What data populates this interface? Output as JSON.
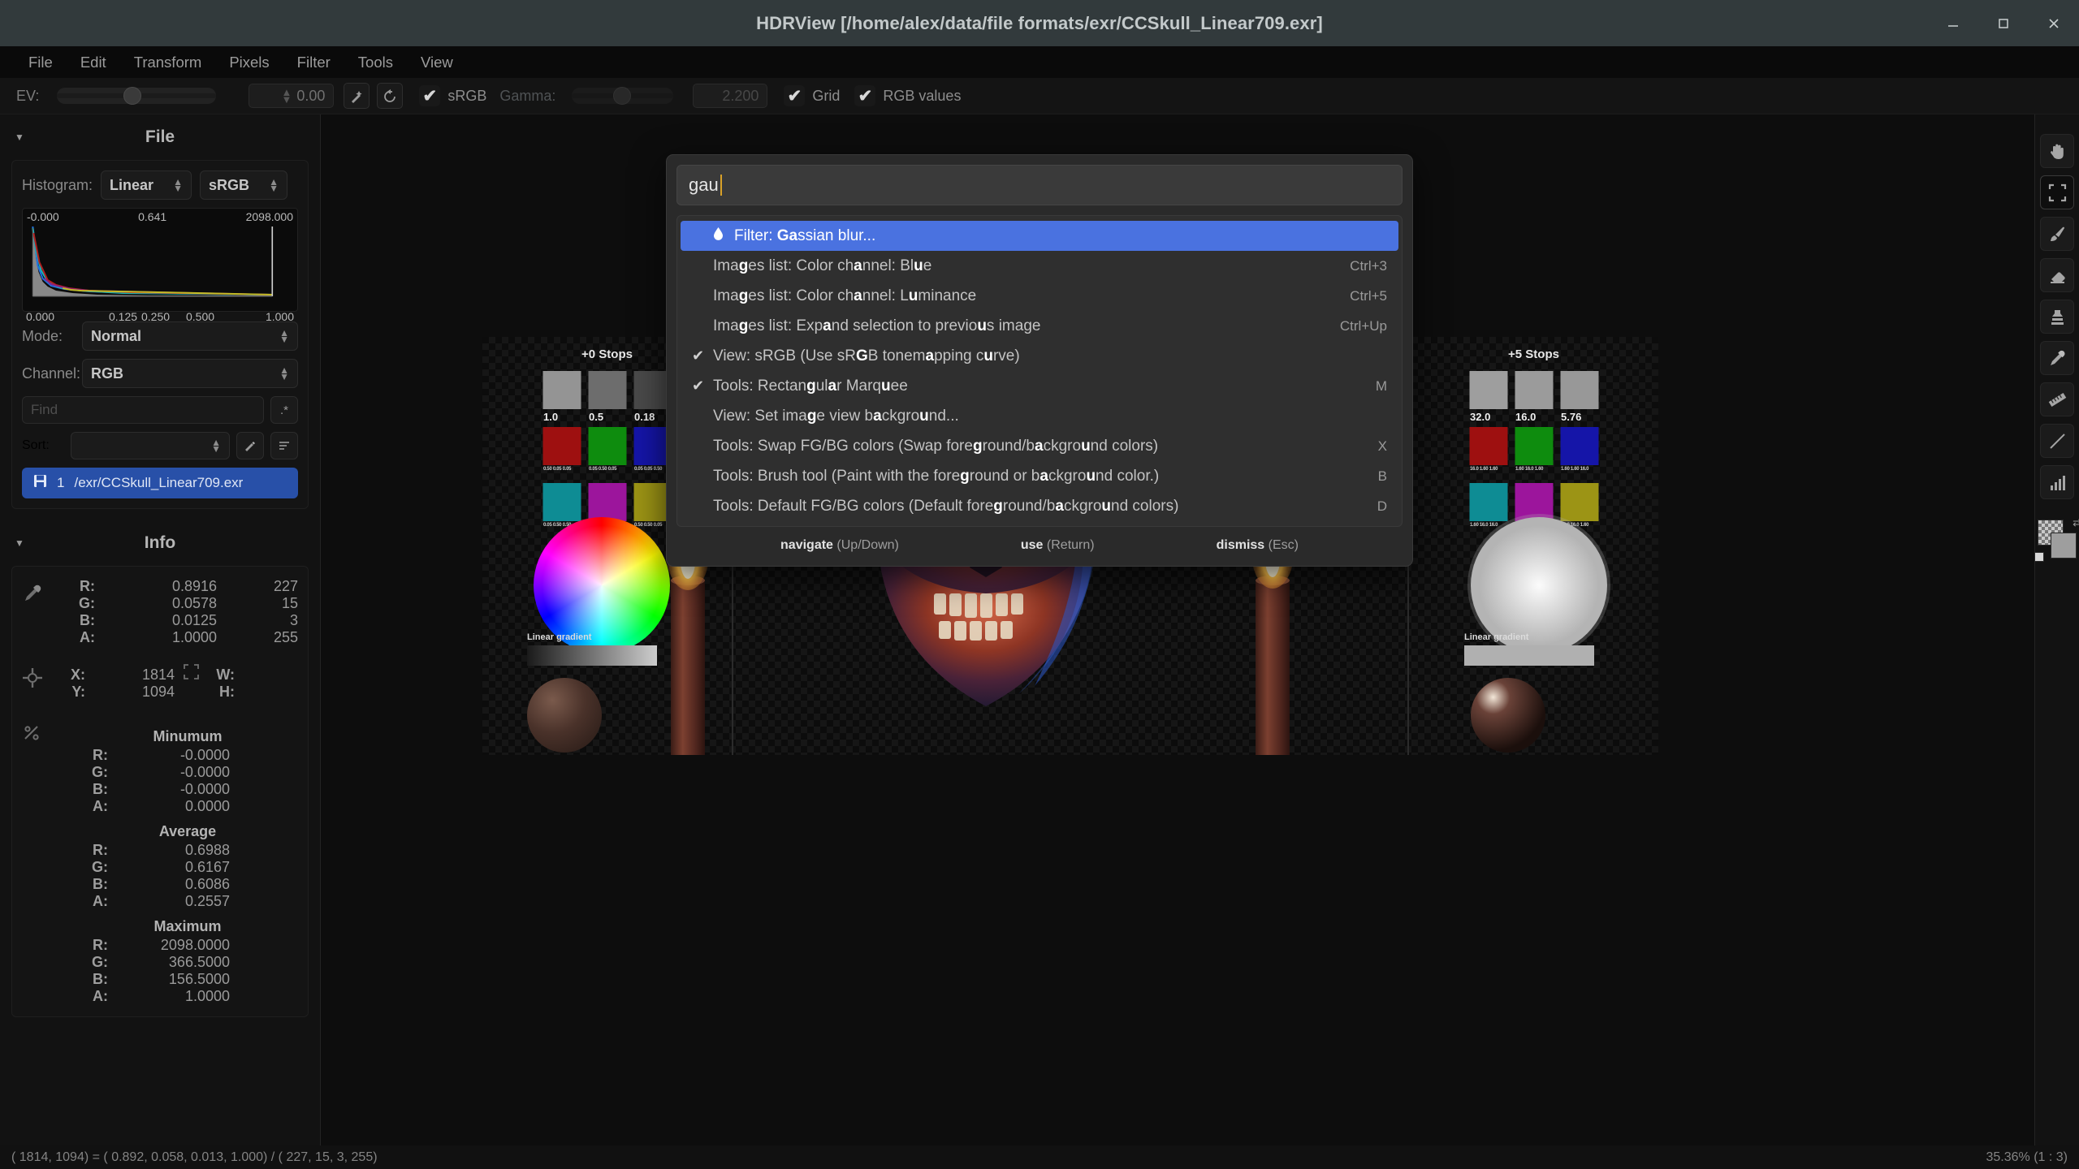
{
  "window": {
    "title": "HDRView [/home/alex/data/file formats/exr/CCSkull_Linear709.exr]",
    "minimize_icon": "minimize-icon",
    "maximize_icon": "maximize-icon",
    "close_icon": "close-icon"
  },
  "menubar": {
    "items": [
      {
        "label": "File"
      },
      {
        "label": "Edit"
      },
      {
        "label": "Transform"
      },
      {
        "label": "Pixels"
      },
      {
        "label": "Filter"
      },
      {
        "label": "Tools"
      },
      {
        "label": "View"
      }
    ]
  },
  "toolbar": {
    "ev_label": "EV:",
    "ev_value": "0.00",
    "auto_exposure_icon": "magic-wand-icon",
    "reset_icon": "reset-icon",
    "srgb_label": "sRGB",
    "srgb_checked": true,
    "gamma_label": "Gamma:",
    "gamma_value": "2.200",
    "gamma_enabled": false,
    "grid_label": "Grid",
    "grid_checked": true,
    "rgb_values_label": "RGB values",
    "rgb_values_checked": true
  },
  "file_panel": {
    "title": "File",
    "collapse_icon": "chevron-down-icon",
    "histogram_label": "Histogram:",
    "histogram_scale": "Linear",
    "histogram_colorspace": "sRGB",
    "hist_top_labels": [
      "-0.000",
      "0.641",
      "2098.000"
    ],
    "hist_bottom_labels": [
      "0.000",
      "0.125",
      "0.250",
      "0.500",
      "1.000"
    ],
    "mode_label": "Mode:",
    "mode_value": "Normal",
    "channel_label": "Channel:",
    "channel_value": "RGB",
    "find_placeholder": "Find",
    "regex_icon": "regex-icon",
    "sort_label": "Sort:",
    "sort_value": "",
    "sort_edit_icon": "pencil-icon",
    "sort_list_icon": "list-icon",
    "files": [
      {
        "index": "1",
        "name": "/exr/CCSkull_Linear709.exr",
        "icon": "save-icon",
        "selected": true
      }
    ]
  },
  "info_panel": {
    "title": "Info",
    "collapse_icon": "chevron-down-icon",
    "eyedropper_icon": "eyedropper-icon",
    "crosshair_icon": "crosshair-icon",
    "stats_icon": "percent-icon",
    "select_icon": "selection-icon",
    "pixel": [
      {
        "k": "R:",
        "v": "0.8916",
        "v2": "227"
      },
      {
        "k": "G:",
        "v": "0.0578",
        "v2": "15"
      },
      {
        "k": "B:",
        "v": "0.0125",
        "v2": "3"
      },
      {
        "k": "A:",
        "v": "1.0000",
        "v2": "255"
      }
    ],
    "coords": {
      "x_label": "X:",
      "x_value": "1814",
      "y_label": "Y:",
      "y_value": "1094",
      "w_label": "W:",
      "w_value": "",
      "h_label": "H:",
      "h_value": ""
    },
    "minimum_title": "Minumum",
    "minimum": [
      {
        "k": "R:",
        "v": "-0.0000"
      },
      {
        "k": "G:",
        "v": "-0.0000"
      },
      {
        "k": "B:",
        "v": "-0.0000"
      },
      {
        "k": "A:",
        "v": "0.0000"
      }
    ],
    "average_title": "Average",
    "average": [
      {
        "k": "R:",
        "v": "0.6988"
      },
      {
        "k": "G:",
        "v": "0.6167"
      },
      {
        "k": "B:",
        "v": "0.6086"
      },
      {
        "k": "A:",
        "v": "0.2557"
      }
    ],
    "maximum_title": "Maximum",
    "maximum": [
      {
        "k": "R:",
        "v": "2098.0000"
      },
      {
        "k": "G:",
        "v": "366.5000"
      },
      {
        "k": "B:",
        "v": "156.5000"
      },
      {
        "k": "A:",
        "v": "1.0000"
      }
    ]
  },
  "canvas": {
    "left_chart": {
      "stops_label": "+0 Stops",
      "gray_captions": [
        "1.0",
        "0.5",
        "0.18"
      ],
      "gradient_label": "Linear gradient"
    },
    "right_chart": {
      "stops_label": "+5 Stops",
      "gray_captions": [
        "32.0",
        "16.0",
        "5.76"
      ],
      "gradient_label": "Linear gradient"
    }
  },
  "right_tools": {
    "items": [
      {
        "name": "hand-tool",
        "icon": "hand-icon",
        "active": false
      },
      {
        "name": "rectangular-marquee-tool",
        "icon": "marquee-icon",
        "active": true
      },
      {
        "name": "brush-tool",
        "icon": "brush-icon",
        "active": false
      },
      {
        "name": "eraser-tool",
        "icon": "eraser-icon",
        "active": false
      },
      {
        "name": "clone-stamp-tool",
        "icon": "stamp-icon",
        "active": false
      },
      {
        "name": "eyedropper-tool",
        "icon": "eyedropper-icon",
        "active": false
      },
      {
        "name": "ruler-tool",
        "icon": "ruler-icon",
        "active": false
      },
      {
        "name": "line-tool",
        "icon": "line-icon",
        "active": false
      },
      {
        "name": "histogram-tool",
        "icon": "bar-chart-icon",
        "active": false
      }
    ],
    "fgbg_swap_icon": "swap-icon",
    "fgbg_default_icon": "default-colors-icon"
  },
  "statusbar": {
    "pixel_readout": "( 1814, 1094) = ( 0.892,  0.058,  0.013,  1.000) / ( 227,  15,   3,  255)",
    "zoom": "35.36% (1 : 3)"
  },
  "command_palette": {
    "query": "gau",
    "items": [
      {
        "icon": "droplet-icon",
        "check": "",
        "selected": true,
        "shortcut": "",
        "parts": [
          {
            "t": "Filter: ",
            "m": false
          },
          {
            "t": "Ga",
            "m": true
          },
          {
            "t": "ssian blur...",
            "m": false
          }
        ]
      },
      {
        "icon": "",
        "check": "",
        "selected": false,
        "shortcut": "Ctrl+3",
        "parts": [
          {
            "t": "Ima",
            "m": false
          },
          {
            "t": "g",
            "m": true
          },
          {
            "t": "es list: Color ch",
            "m": false
          },
          {
            "t": "a",
            "m": true
          },
          {
            "t": "nnel: Bl",
            "m": false
          },
          {
            "t": "u",
            "m": true
          },
          {
            "t": "e",
            "m": false
          }
        ]
      },
      {
        "icon": "",
        "check": "",
        "selected": false,
        "shortcut": "Ctrl+5",
        "parts": [
          {
            "t": "Ima",
            "m": false
          },
          {
            "t": "g",
            "m": true
          },
          {
            "t": "es list: Color ch",
            "m": false
          },
          {
            "t": "a",
            "m": true
          },
          {
            "t": "nnel: L",
            "m": false
          },
          {
            "t": "u",
            "m": true
          },
          {
            "t": "minance",
            "m": false
          }
        ]
      },
      {
        "icon": "",
        "check": "",
        "selected": false,
        "shortcut": "Ctrl+Up",
        "parts": [
          {
            "t": "Ima",
            "m": false
          },
          {
            "t": "g",
            "m": true
          },
          {
            "t": "es list: Exp",
            "m": false
          },
          {
            "t": "a",
            "m": true
          },
          {
            "t": "nd selection to previo",
            "m": false
          },
          {
            "t": "u",
            "m": true
          },
          {
            "t": "s image",
            "m": false
          }
        ]
      },
      {
        "icon": "",
        "check": "✔",
        "selected": false,
        "shortcut": "",
        "parts": [
          {
            "t": "View: sRGB (Use sR",
            "m": false
          },
          {
            "t": "G",
            "m": true
          },
          {
            "t": "B tonem",
            "m": false
          },
          {
            "t": "a",
            "m": true
          },
          {
            "t": "pping c",
            "m": false
          },
          {
            "t": "u",
            "m": true
          },
          {
            "t": "rve)",
            "m": false
          }
        ]
      },
      {
        "icon": "",
        "check": "✔",
        "selected": false,
        "shortcut": "M",
        "parts": [
          {
            "t": "Tools: Rectan",
            "m": false
          },
          {
            "t": "g",
            "m": true
          },
          {
            "t": "ul",
            "m": false
          },
          {
            "t": "a",
            "m": true
          },
          {
            "t": "r Marq",
            "m": false
          },
          {
            "t": "u",
            "m": true
          },
          {
            "t": "ee",
            "m": false
          }
        ]
      },
      {
        "icon": "",
        "check": "",
        "selected": false,
        "shortcut": "",
        "parts": [
          {
            "t": "View: Set ima",
            "m": false
          },
          {
            "t": "g",
            "m": true
          },
          {
            "t": "e view b",
            "m": false
          },
          {
            "t": "a",
            "m": true
          },
          {
            "t": "ckgro",
            "m": false
          },
          {
            "t": "u",
            "m": true
          },
          {
            "t": "nd...",
            "m": false
          }
        ]
      },
      {
        "icon": "",
        "check": "",
        "selected": false,
        "shortcut": "X",
        "parts": [
          {
            "t": "Tools: Swap FG/BG colors (Swap fore",
            "m": false
          },
          {
            "t": "g",
            "m": true
          },
          {
            "t": "round/b",
            "m": false
          },
          {
            "t": "a",
            "m": true
          },
          {
            "t": "ckgro",
            "m": false
          },
          {
            "t": "u",
            "m": true
          },
          {
            "t": "nd colors)",
            "m": false
          }
        ]
      },
      {
        "icon": "",
        "check": "",
        "selected": false,
        "shortcut": "B",
        "parts": [
          {
            "t": "Tools: Brush tool (Paint with the fore",
            "m": false
          },
          {
            "t": "g",
            "m": true
          },
          {
            "t": "round or b",
            "m": false
          },
          {
            "t": "a",
            "m": true
          },
          {
            "t": "ckgro",
            "m": false
          },
          {
            "t": "u",
            "m": true
          },
          {
            "t": "nd color.)",
            "m": false
          }
        ]
      },
      {
        "icon": "",
        "check": "",
        "selected": false,
        "shortcut": "D",
        "parts": [
          {
            "t": "Tools: Default FG/BG colors (Default fore",
            "m": false
          },
          {
            "t": "g",
            "m": true
          },
          {
            "t": "round/b",
            "m": false
          },
          {
            "t": "a",
            "m": true
          },
          {
            "t": "ckgro",
            "m": false
          },
          {
            "t": "u",
            "m": true
          },
          {
            "t": "nd colors)",
            "m": false
          }
        ]
      }
    ],
    "footer": [
      {
        "action": "navigate",
        "key": "(Up/Down)"
      },
      {
        "action": "use",
        "key": "(Return)"
      },
      {
        "action": "dismiss",
        "key": "(Esc)"
      }
    ]
  },
  "colors": {
    "accent_blue": "#4a72e0",
    "file_selected": "#2850a8",
    "titlebar": "#323a3c",
    "caret": "#d8a128"
  }
}
